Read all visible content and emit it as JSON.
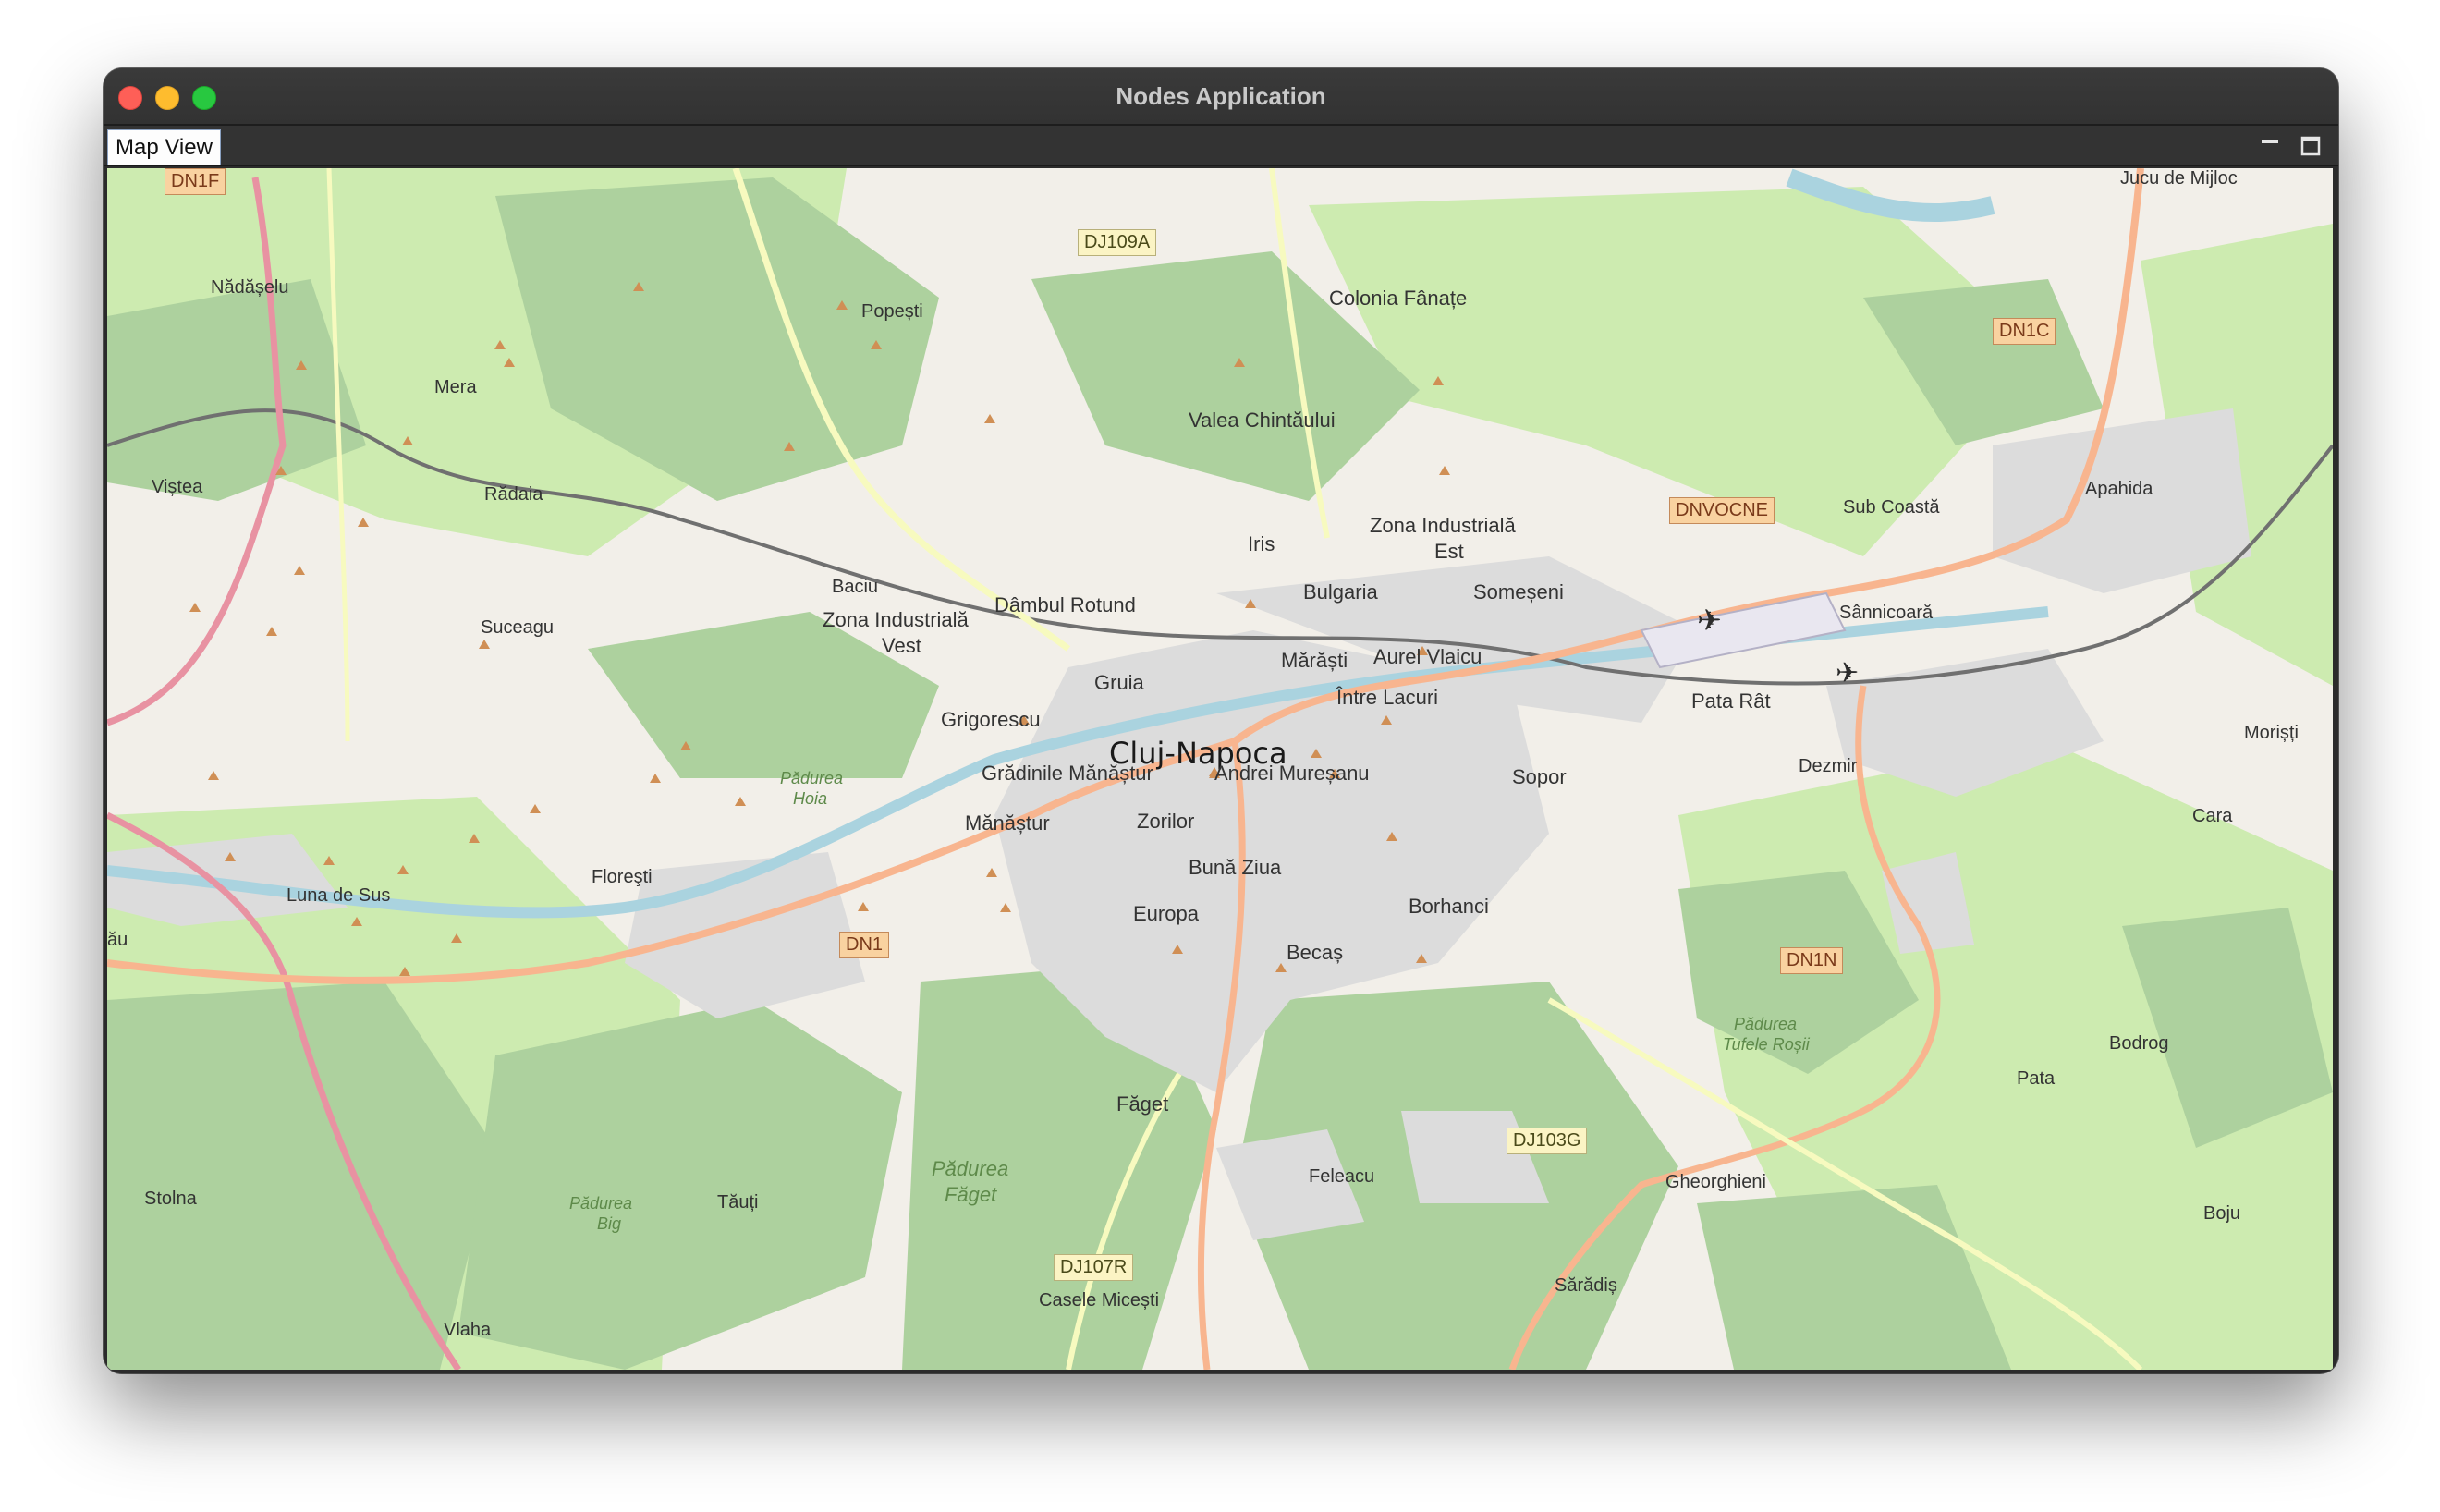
{
  "window": {
    "title": "Nodes Application"
  },
  "tabs": [
    {
      "label": "Map View",
      "active": true
    }
  ],
  "toolbar_icons": [
    "minimize-icon",
    "maximize-icon"
  ],
  "map": {
    "colors": {
      "background": "#f2efe9",
      "forest": "#add19e",
      "meadow": "#cdebb0",
      "urban": "#dddddd",
      "water": "#aad3df",
      "road_major": "#f8b58f",
      "road_trunk": "#e892a2",
      "road_secondary": "#f7fabf",
      "rail": "#707070",
      "peak": "#d08f55"
    },
    "labels": {
      "city": "Cluj-Napoca",
      "roads": [
        "DN1F",
        "DJ109A",
        "DN1C",
        "DNVOCNE",
        "DN1",
        "DN1N",
        "DJ103G",
        "DJ107R"
      ],
      "places": [
        "Jucu de Mijloc",
        "Nădășelu",
        "Popești",
        "Colonia Fânațe",
        "Mera",
        "Valea Chintăului",
        "Viștea",
        "Rădaia",
        "Sub Coastă",
        "Apahida",
        "Zona Industrială",
        "Est",
        "Iris",
        "Bulgaria",
        "Someșeni",
        "Dâmbul Rotund",
        "Baciu",
        "Zona Industrială",
        "Vest",
        "Sânnicoară",
        "Suceagu",
        "Mărăști",
        "Aurel Vlaicu",
        "Grigorescu",
        "Gruia",
        "Între Lacuri",
        "Pata Rât",
        "Morișți",
        "Grădinile Mănăștur",
        "Andrei Mureșanu",
        "Sopor",
        "Dezmir",
        "Mănăștur",
        "Zorilor",
        "Cara",
        "Floreşti",
        "Bună Ziua",
        "Luna de Sus",
        "Europa",
        "Borhanci",
        "Becaș",
        "Bodrog",
        "Făget",
        "Pata",
        "Feleacu",
        "Gheorghieni",
        "Stolna",
        "Tăuți",
        "Boju",
        "Sărădiș",
        "Casele Micești",
        "Vlaha",
        "ău"
      ],
      "forests": [
        "Pădurea",
        "Hoia",
        "Pădurea",
        "Făget",
        "Pădurea",
        "Big",
        "Pădurea",
        "Tufele Roșii"
      ]
    }
  }
}
